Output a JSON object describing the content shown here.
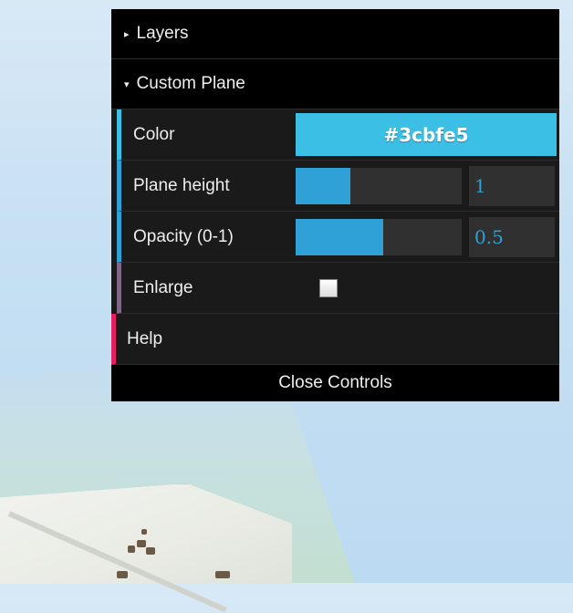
{
  "panel": {
    "layers_folder": {
      "label": "Layers",
      "icon": "triangle-right-icon"
    },
    "custom_plane_folder": {
      "label": "Custom Plane",
      "icon": "triangle-down-icon"
    },
    "color": {
      "label": "Color",
      "value": "#3cbfe5"
    },
    "plane_height": {
      "label": "Plane height",
      "value": "1",
      "fraction": 0.33
    },
    "opacity": {
      "label": "Opacity (0-1)",
      "value": "0.5",
      "fraction": 0.53
    },
    "enlarge": {
      "label": "Enlarge",
      "checked": false
    },
    "help": {
      "label": "Help"
    },
    "close_controls": {
      "label": "Close Controls"
    }
  },
  "colors": {
    "panel_bg": "#1a1a1a",
    "number_accent": "#2fa1d6",
    "bool_accent": "#806787",
    "function_accent": "#e61d5f"
  }
}
